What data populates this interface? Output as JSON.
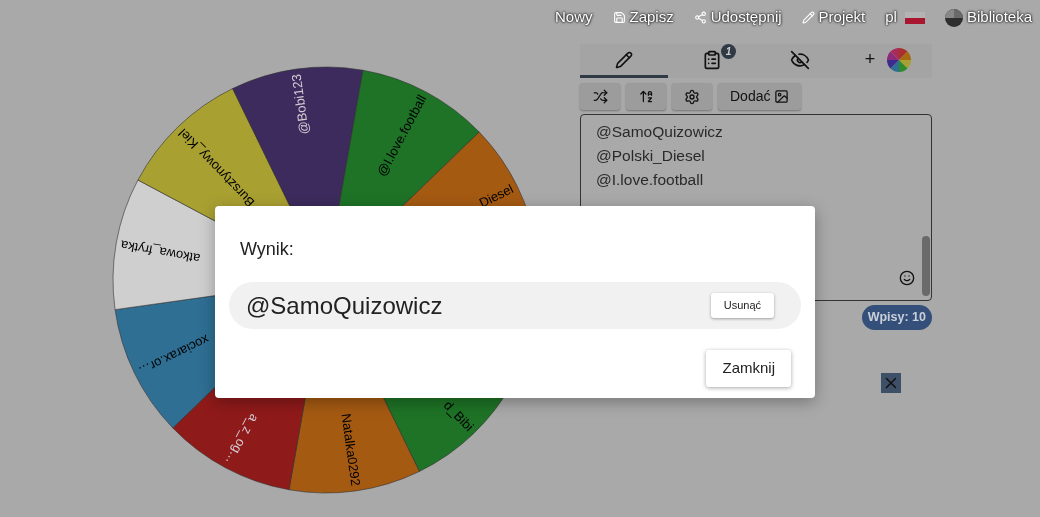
{
  "nav": [
    {
      "kind": "text",
      "label": "Nowy"
    },
    {
      "kind": "save",
      "label": "Zapisz"
    },
    {
      "kind": "share",
      "label": "Udostępnij"
    },
    {
      "kind": "pencil",
      "label": "Projekt"
    },
    {
      "kind": "language",
      "label": "pl"
    },
    {
      "kind": "library",
      "label": "Biblioteka"
    }
  ],
  "wheel": {
    "segments": [
      {
        "label": "d_Bibi",
        "color": "#1e7326",
        "light_label": false
      },
      {
        "label": "Natalka0292",
        "color": "#a55a12",
        "light_label": false
      },
      {
        "label": "a_z_og…",
        "color": "#8f1a1a",
        "light_label": true
      },
      {
        "label": "xociarax.or…",
        "color": "#2f6f93",
        "light_label": false
      },
      {
        "label": "atkowa_frytka",
        "color": "#cfcfcf",
        "light_label": false
      },
      {
        "label": "Bursztynowy_Kiel",
        "color": "#a9a032",
        "light_label": false
      },
      {
        "label": "@Bobi123",
        "color": "#3c2b5c",
        "light_label": true
      },
      {
        "label": "@I.love.football",
        "color": "#1e7326",
        "light_label": false
      },
      {
        "label": "Diesel",
        "color": "#a55a12",
        "light_label": false
      }
    ]
  },
  "tabs": [
    {
      "kind": "edit",
      "selected": true
    },
    {
      "kind": "results",
      "selected": false,
      "badge": "1"
    },
    {
      "kind": "hidden",
      "selected": false
    },
    {
      "kind": "colors",
      "selected": false,
      "label": "+"
    }
  ],
  "toolbar": [
    {
      "kind": "shuffle"
    },
    {
      "kind": "sort"
    },
    {
      "kind": "settings"
    },
    {
      "kind": "image",
      "label": "Dodać"
    }
  ],
  "entries": [
    "@SamoQuizowicz",
    "@Polski_Diesel",
    "@I.love.football"
  ],
  "entries_count": "Wpisy: 10",
  "dialog": {
    "title": "Wynik:",
    "result": "@SamoQuizowicz",
    "remove_button": "Usunąć",
    "close_button": "Zamknij"
  }
}
